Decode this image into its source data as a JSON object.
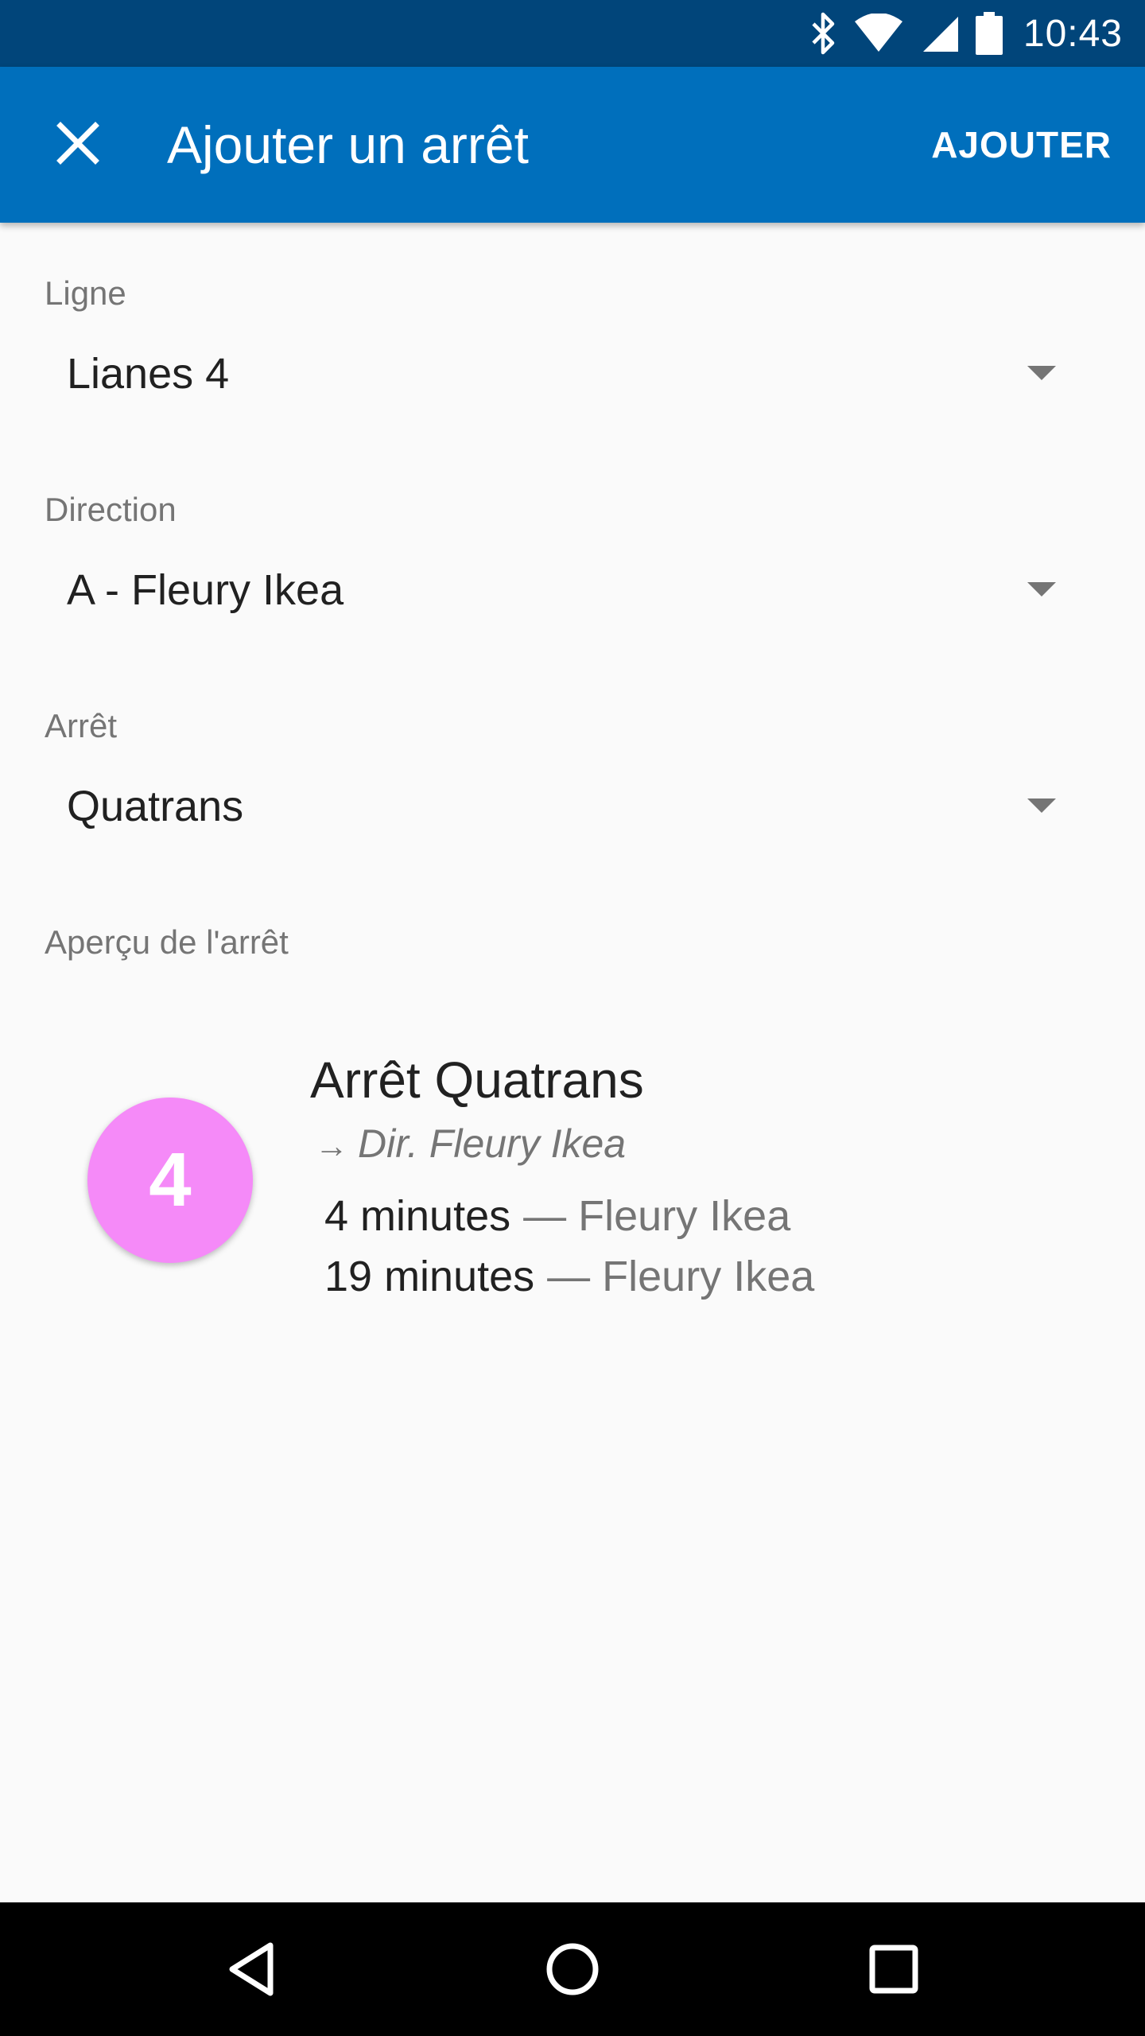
{
  "status_bar": {
    "time": "10:43",
    "icons": [
      "bluetooth-icon",
      "wifi-icon",
      "signal-icon",
      "battery-icon"
    ]
  },
  "app_bar": {
    "title": "Ajouter un arrêt",
    "action_label": "AJOUTER",
    "color": "#006fbc",
    "close_icon": "close-icon"
  },
  "form": {
    "line": {
      "label": "Ligne",
      "value": "Lianes 4"
    },
    "direction": {
      "label": "Direction",
      "value": "A - Fleury Ikea"
    },
    "stop": {
      "label": "Arrêt",
      "value": "Quatrans"
    }
  },
  "preview": {
    "label": "Aperçu de l'arrêt",
    "badge": {
      "text": "4",
      "color": "#f58af8"
    },
    "stop_name": "Arrêt Quatrans",
    "direction_arrow": "→",
    "direction": "Dir. Fleury Ikea",
    "departures": [
      {
        "time": "4 minutes",
        "destination": "— Fleury Ikea"
      },
      {
        "time": "19 minutes",
        "destination": "— Fleury Ikea"
      }
    ]
  },
  "nav_bar": {
    "buttons": [
      "back-icon",
      "home-icon",
      "recents-icon"
    ]
  }
}
